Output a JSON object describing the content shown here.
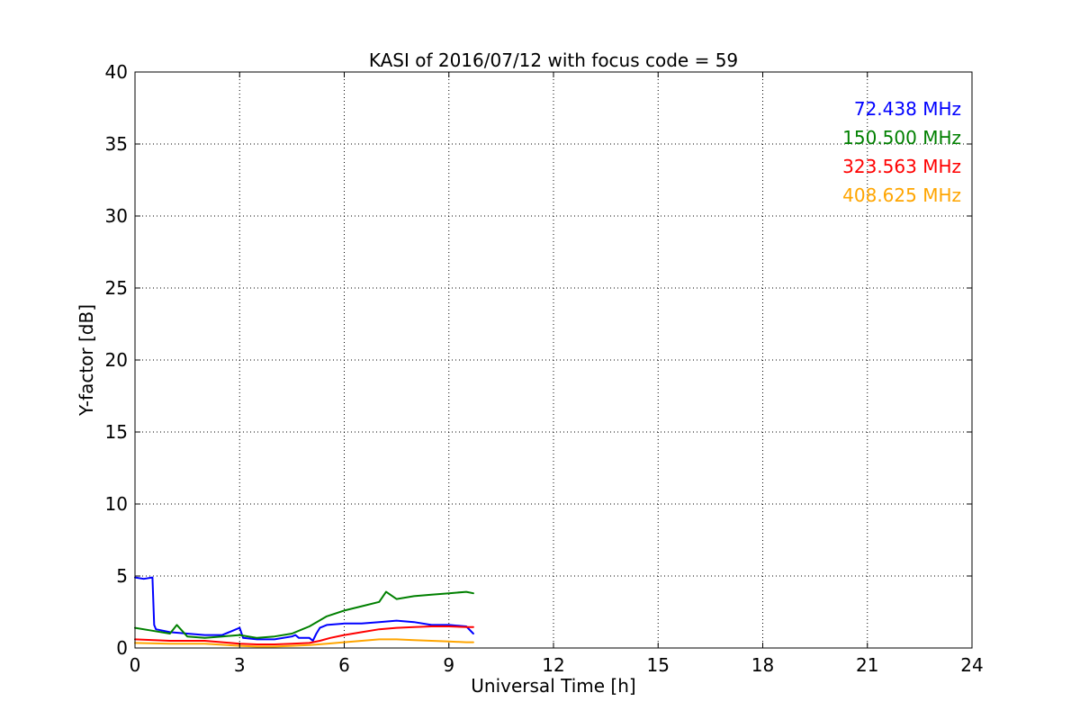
{
  "chart_data": {
    "type": "line",
    "title": "KASI of 2016/07/12 with focus code = 59",
    "xlabel": "Universal Time [h]",
    "ylabel": "Y-factor [dB]",
    "xlim": [
      0,
      24
    ],
    "ylim": [
      0,
      40
    ],
    "x_ticks": [
      0,
      3,
      6,
      9,
      12,
      15,
      18,
      21,
      24
    ],
    "y_ticks": [
      0,
      5,
      10,
      15,
      20,
      25,
      30,
      35,
      40
    ],
    "x_tick_labels": [
      "0",
      "3",
      "6",
      "9",
      "12",
      "15",
      "18",
      "21",
      "24"
    ],
    "y_tick_labels": [
      "0",
      "5",
      "10",
      "15",
      "20",
      "25",
      "30",
      "35",
      "40"
    ],
    "grid": true,
    "legend_placement": "top-right",
    "series": [
      {
        "name": "72.438 MHz",
        "color": "#0000ff",
        "x": [
          0,
          0.25,
          0.5,
          0.55,
          0.6,
          1.0,
          1.5,
          2.0,
          2.5,
          2.8,
          3.0,
          3.1,
          3.5,
          4.0,
          4.5,
          4.6,
          4.7,
          5.0,
          5.1,
          5.2,
          5.3,
          5.5,
          6.0,
          6.5,
          7.0,
          7.5,
          8.0,
          8.5,
          9.0,
          9.5,
          9.7
        ],
        "y": [
          4.9,
          4.8,
          4.9,
          1.6,
          1.3,
          1.1,
          1.0,
          0.9,
          0.9,
          1.2,
          1.4,
          0.7,
          0.6,
          0.6,
          0.8,
          0.9,
          0.7,
          0.7,
          0.5,
          1.0,
          1.4,
          1.6,
          1.7,
          1.7,
          1.8,
          1.9,
          1.8,
          1.6,
          1.6,
          1.5,
          1.0
        ]
      },
      {
        "name": "150.500 MHz",
        "color": "#008000",
        "x": [
          0,
          0.5,
          1.0,
          1.2,
          1.5,
          2.0,
          2.5,
          3.0,
          3.5,
          4.0,
          4.5,
          4.8,
          5.0,
          5.5,
          6.0,
          6.5,
          7.0,
          7.2,
          7.5,
          8.0,
          8.5,
          9.0,
          9.5,
          9.7
        ],
        "y": [
          1.4,
          1.2,
          1.0,
          1.6,
          0.8,
          0.7,
          0.8,
          0.9,
          0.7,
          0.8,
          1.0,
          1.3,
          1.5,
          2.2,
          2.6,
          2.9,
          3.2,
          3.9,
          3.4,
          3.6,
          3.7,
          3.8,
          3.9,
          3.8
        ]
      },
      {
        "name": "323.563 MHz",
        "color": "#ff0000",
        "x": [
          0,
          1.0,
          2.0,
          3.0,
          3.5,
          4.0,
          4.5,
          5.0,
          5.3,
          5.6,
          6.0,
          6.5,
          7.0,
          7.5,
          8.0,
          8.5,
          9.0,
          9.5,
          9.7
        ],
        "y": [
          0.6,
          0.5,
          0.5,
          0.3,
          0.25,
          0.25,
          0.3,
          0.35,
          0.5,
          0.7,
          0.9,
          1.1,
          1.3,
          1.4,
          1.45,
          1.5,
          1.5,
          1.45,
          1.45
        ]
      },
      {
        "name": "408.625 MHz",
        "color": "#ffa500",
        "x": [
          0,
          1.0,
          2.0,
          3.0,
          3.5,
          4.0,
          4.5,
          5.0,
          5.5,
          6.0,
          6.5,
          7.0,
          7.5,
          8.0,
          8.5,
          9.0,
          9.5,
          9.7
        ],
        "y": [
          0.35,
          0.3,
          0.3,
          0.15,
          0.1,
          0.1,
          0.15,
          0.2,
          0.3,
          0.4,
          0.5,
          0.6,
          0.6,
          0.55,
          0.5,
          0.45,
          0.4,
          0.4
        ]
      }
    ]
  }
}
